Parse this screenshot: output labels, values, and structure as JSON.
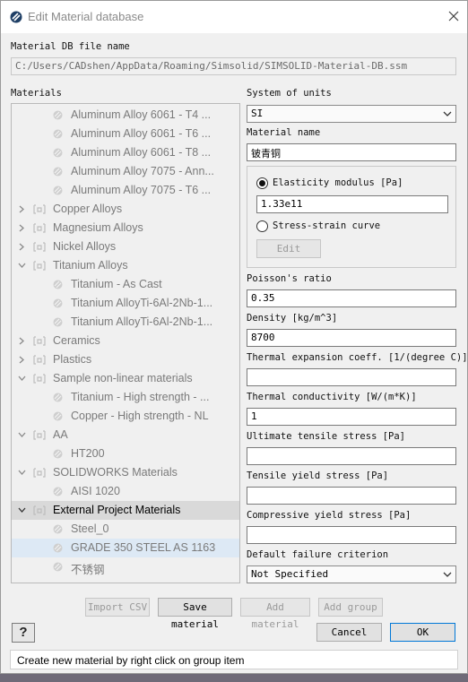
{
  "window": {
    "title": "Edit Material database"
  },
  "db_file": {
    "label": "Material DB file name",
    "value": "C:/Users/CADshen/AppData/Roaming/Simsolid/SIMSOLID-Material-DB.ssm"
  },
  "materials": {
    "label": "Materials",
    "tree": [
      {
        "type": "material",
        "label": "Aluminum Alloy 6061 - T4 ..."
      },
      {
        "type": "material",
        "label": "Aluminum Alloy 6061 - T6 ..."
      },
      {
        "type": "material",
        "label": "Aluminum Alloy 6061 - T8 ..."
      },
      {
        "type": "material",
        "label": "Aluminum Alloy 7075 - Ann..."
      },
      {
        "type": "material",
        "label": "Aluminum Alloy 7075 - T6 ..."
      },
      {
        "type": "group",
        "label": "Copper Alloys",
        "expanded": false
      },
      {
        "type": "group",
        "label": "Magnesium Alloys",
        "expanded": false
      },
      {
        "type": "group",
        "label": "Nickel Alloys",
        "expanded": false
      },
      {
        "type": "group",
        "label": "Titanium Alloys",
        "expanded": true
      },
      {
        "type": "material",
        "label": "Titanium - As Cast"
      },
      {
        "type": "material",
        "label": "Titanium AlloyTi-6Al-2Nb-1..."
      },
      {
        "type": "material",
        "label": "Titanium AlloyTi-6Al-2Nb-1..."
      },
      {
        "type": "group",
        "label": "Ceramics",
        "expanded": false
      },
      {
        "type": "group",
        "label": "Plastics",
        "expanded": false
      },
      {
        "type": "group",
        "label": "Sample non-linear materials",
        "expanded": true
      },
      {
        "type": "material",
        "label": "Titanium - High strength - ..."
      },
      {
        "type": "material",
        "label": "Copper - High strength - NL"
      },
      {
        "type": "group",
        "label": "AA",
        "expanded": true
      },
      {
        "type": "material",
        "label": "HT200"
      },
      {
        "type": "group",
        "label": "SOLIDWORKS Materials",
        "expanded": true
      },
      {
        "type": "material",
        "label": "AISI 1020"
      },
      {
        "type": "group",
        "label": "External Project Materials",
        "expanded": true,
        "selected": true
      },
      {
        "type": "material",
        "label": "Steel_0"
      },
      {
        "type": "material",
        "label": "GRADE 350 STEEL AS 1163",
        "hovered": true
      },
      {
        "type": "material",
        "label": "不锈钢"
      }
    ]
  },
  "units": {
    "label": "System of units",
    "value": "SI"
  },
  "material_name": {
    "label": "Material name",
    "value": "铍青铜"
  },
  "elasticity": {
    "label": "Elasticity modulus [Pa]",
    "value": "1.33e11",
    "selected": true
  },
  "stress_strain": {
    "label": "Stress-strain curve",
    "edit_label": "Edit"
  },
  "poisson": {
    "label": "Poisson's ratio",
    "value": "0.35"
  },
  "density": {
    "label": "Density [kg/m^3]",
    "value": "8700"
  },
  "thermal_expansion": {
    "label": "Thermal expansion coeff. [1/(degree C)]",
    "value": ""
  },
  "thermal_conductivity": {
    "label": "Thermal conductivity [W/(m*K)]",
    "value": "1"
  },
  "uts": {
    "label": "Ultimate tensile stress [Pa]",
    "value": ""
  },
  "tys": {
    "label": "Tensile yield stress [Pa]",
    "value": ""
  },
  "cys": {
    "label": "Compressive yield stress [Pa]",
    "value": ""
  },
  "failure": {
    "label": "Default failure criterion",
    "value": "Not Specified"
  },
  "buttons": {
    "import_csv": "Import CSV",
    "save_material": "Save material",
    "add_material": "Add material",
    "add_group": "Add group",
    "cancel": "Cancel",
    "ok": "OK",
    "help": "?"
  },
  "status": "Create new material by right click on group item"
}
